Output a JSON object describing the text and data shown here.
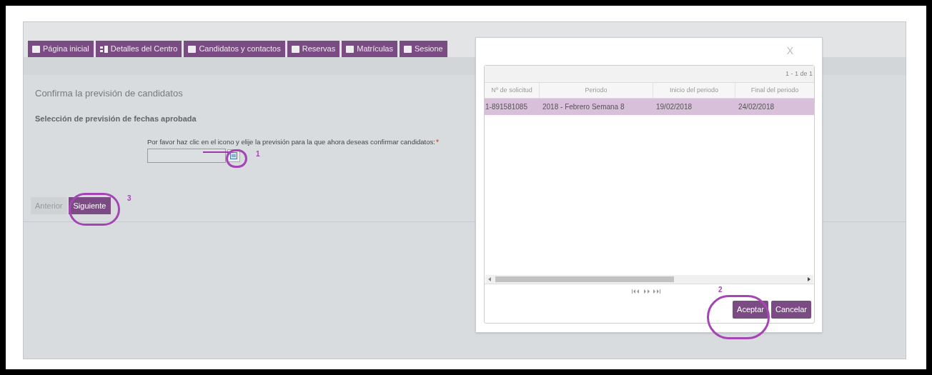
{
  "tabs": [
    {
      "label": "Página inicial",
      "kind": "square"
    },
    {
      "label": "Detalles del Centro",
      "kind": "grid"
    },
    {
      "label": "Candidatos y contactos",
      "kind": "square"
    },
    {
      "label": "Reservas",
      "kind": "square"
    },
    {
      "label": "Matrículas",
      "kind": "square"
    },
    {
      "label": "Sesione",
      "kind": "square"
    }
  ],
  "form": {
    "title": "Confirma la previsión de candidatos",
    "section": "Selección de previsión de fechas aprobada",
    "field_label": "Por favor haz clic en el icono y elije la previsión para la que ahora deseas confirmar candidatos:",
    "required_mark": "*"
  },
  "nav_buttons": [
    {
      "label": "Anterior",
      "disabled": true
    },
    {
      "label": "Siguiente",
      "disabled": false
    }
  ],
  "dialog": {
    "close": "X",
    "count": "1 - 1 de 1",
    "columns": [
      "Nº de solicitud",
      "Periodo",
      "Inicio del periodo",
      "Final del periodo"
    ],
    "rows": [
      {
        "cells": [
          "1-891581085",
          "2018 - Febrero Semana 8",
          "19/02/2018",
          "24/02/2018"
        ],
        "selected": true
      }
    ],
    "buttons": [
      "Aceptar",
      "Cancelar"
    ]
  },
  "annotations": [
    {
      "label": "1"
    },
    {
      "label": "2"
    },
    {
      "label": "3"
    }
  ]
}
